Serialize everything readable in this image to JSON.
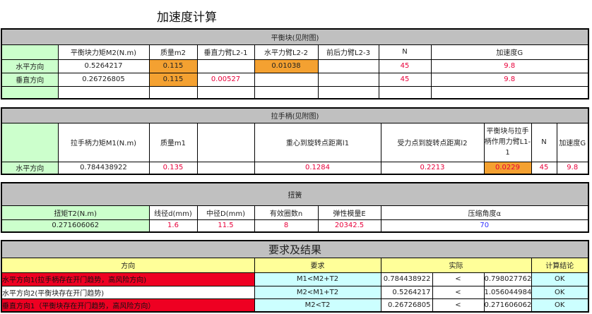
{
  "title": "加速度计算",
  "s1": {
    "title": "平衡块(见附图)",
    "headers": [
      "",
      "平衡块力矩M2(N.m)",
      "质量m2",
      "垂直力臂L2-1",
      "水平力臂L2-2",
      "前后力臂L2-3",
      "N",
      "加速度G"
    ],
    "rows": [
      [
        "水平方向",
        "0.5264217",
        "0.115",
        "",
        "0.01038",
        "",
        "45",
        "9.8"
      ],
      [
        "垂直方向",
        "0.26726805",
        "0.115",
        "0.00527",
        "",
        "",
        "45",
        "9.8"
      ]
    ]
  },
  "s2": {
    "title": "拉手柄(见附图)",
    "headers": [
      "",
      "拉手柄力矩M1(N.m)",
      "质量m1",
      "",
      "重心到旋转点距离l1",
      "受力点到旋转点距离l2",
      "平衡块与拉手柄作用力臂L1-1",
      "N",
      "加速度G"
    ],
    "row": [
      "水平方向",
      "0.784438922",
      "0.135",
      "",
      "0.1284",
      "0.2213",
      "0.0229",
      "45",
      "9.8"
    ]
  },
  "s3": {
    "title": "扭簧",
    "headers": [
      "扭矩T2(N.m)",
      "线径d(mm)",
      "中径D(mm)",
      "有效圈数n",
      "弹性模量E",
      "压缩角度α"
    ],
    "row": [
      "0.271606062",
      "1.6",
      "11.5",
      "8",
      "20342.5",
      "70"
    ]
  },
  "s4": {
    "title": "要求及结果",
    "headers": [
      "方向",
      "要求",
      "实际",
      "计算结论"
    ],
    "rows": [
      [
        "水平方向1(拉手柄存在开门趋势，高风险方向)",
        "M1<M2+T2",
        "0.784438922",
        "<",
        "0.798027762",
        "OK"
      ],
      [
        "水平方向2(平衡块存在开门趋势)",
        "M2<M1+T2",
        "0.5264217",
        "<",
        "1.056044984",
        "OK"
      ],
      [
        "垂直方向1（平衡块存在开门趋势，高风险方向）",
        "M2<T2",
        "0.26726805",
        "<",
        "0.271606062",
        "OK"
      ]
    ]
  }
}
